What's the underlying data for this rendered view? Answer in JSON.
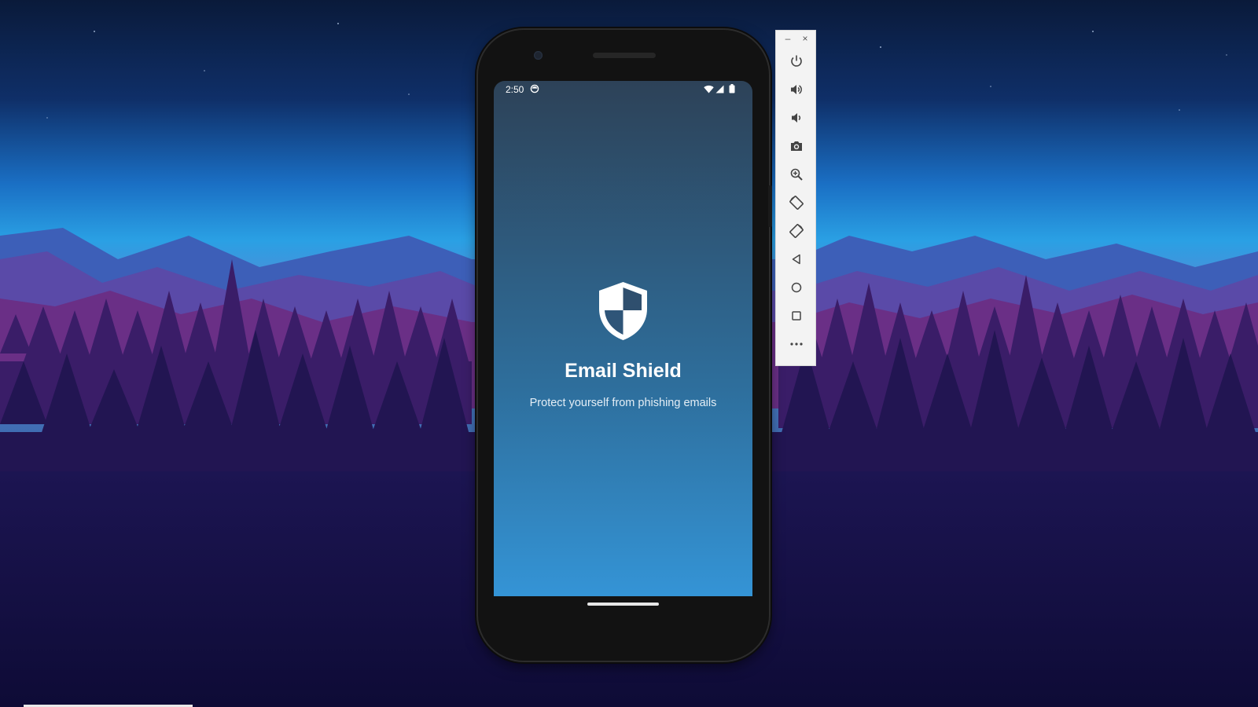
{
  "screen": {
    "status_bar": {
      "time": "2:50"
    },
    "app": {
      "title": "Email Shield",
      "tagline": "Protect yourself from phishing emails"
    }
  },
  "emulator_toolbar": {
    "window_controls": {
      "minimize": "–",
      "close": "×"
    },
    "buttons": [
      {
        "icon": "power-icon"
      },
      {
        "icon": "volume-up-icon"
      },
      {
        "icon": "volume-down-icon"
      },
      {
        "icon": "camera-icon"
      },
      {
        "icon": "zoom-icon"
      },
      {
        "icon": "rotate-left-icon"
      },
      {
        "icon": "rotate-right-icon"
      },
      {
        "icon": "back-icon"
      },
      {
        "icon": "home-icon"
      },
      {
        "icon": "overview-icon"
      },
      {
        "icon": "more-icon"
      }
    ]
  },
  "colors": {
    "screen_gradient_top": "#2d4258",
    "screen_gradient_bottom": "#3494d6",
    "toolbar_background": "#f3f3f3"
  }
}
